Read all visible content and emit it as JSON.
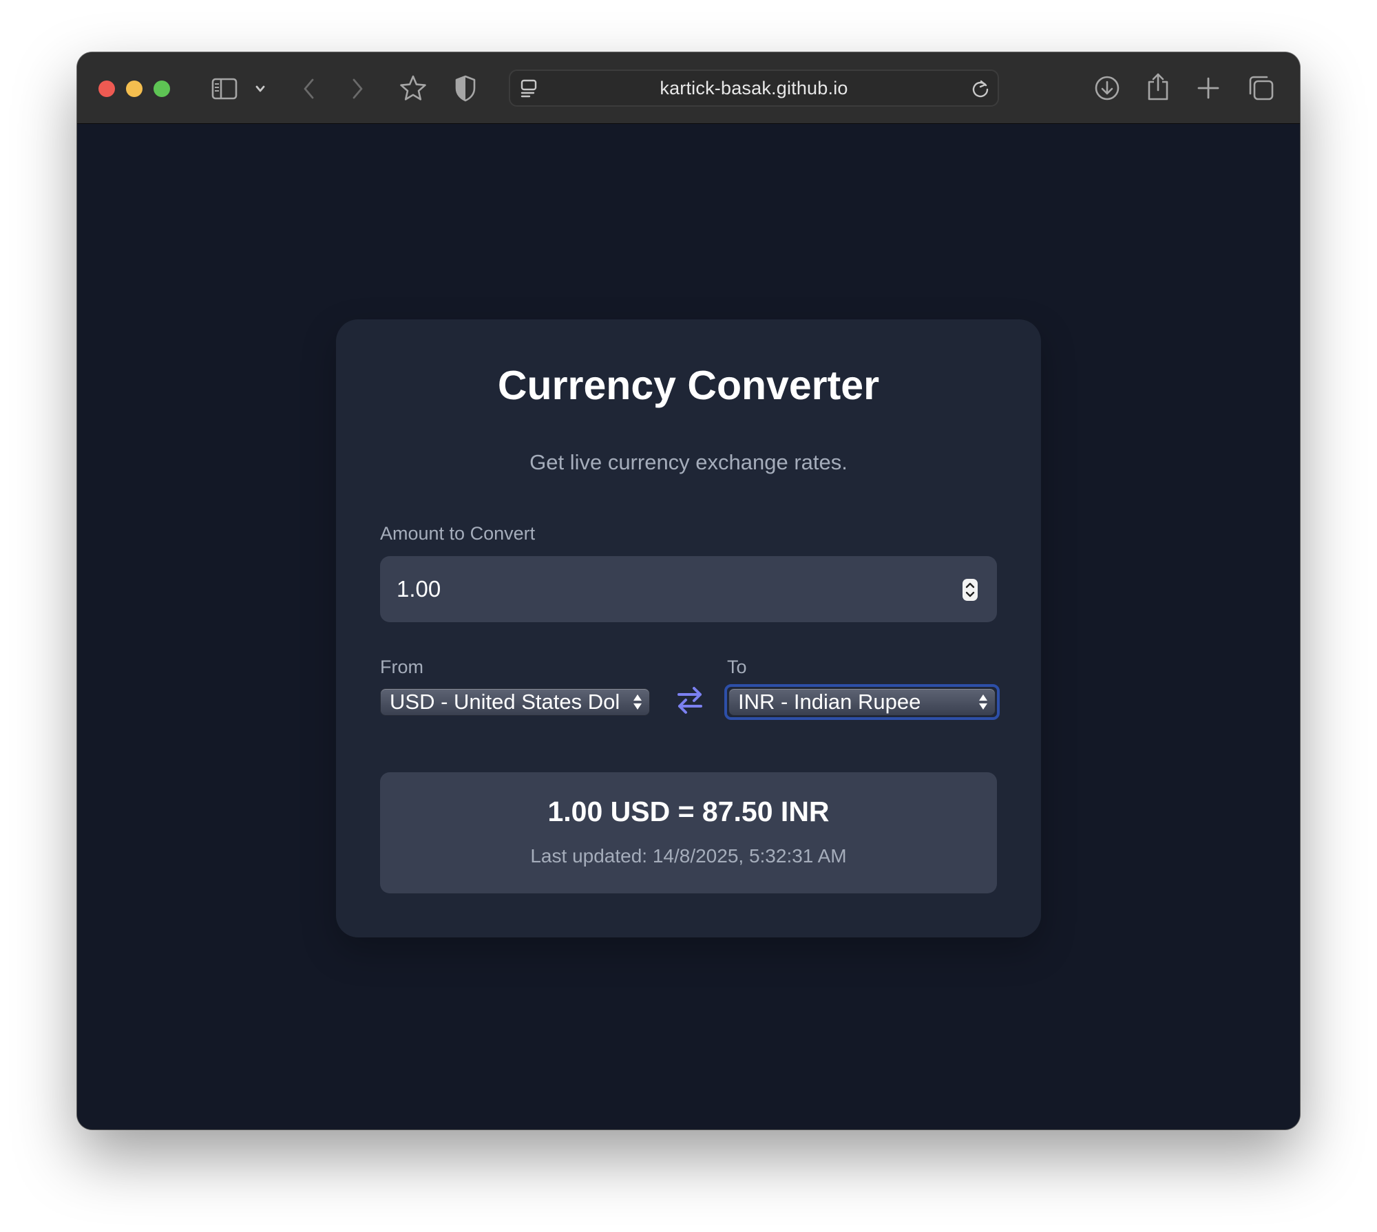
{
  "browser": {
    "url": "kartick-basak.github.io",
    "colors": {
      "close": "#ee5a52",
      "minimize": "#f4be4f",
      "maximize": "#5ec454",
      "chrome": "#2e2e2e"
    },
    "icons": [
      "sidebar-icon",
      "chevron-down-icon",
      "back-icon",
      "forward-icon",
      "star-icon",
      "shield-icon",
      "page-menu-icon",
      "reload-icon",
      "download-icon",
      "share-icon",
      "plus-icon",
      "tabs-overview-icon"
    ]
  },
  "app": {
    "title": "Currency Converter",
    "subtitle": "Get live currency exchange rates.",
    "amount": {
      "label": "Amount to Convert",
      "value": "1.00"
    },
    "from": {
      "label": "From",
      "selected": "USD - United States Dollar"
    },
    "to": {
      "label": "To",
      "selected": "INR - Indian Rupee"
    },
    "result": {
      "conversion": "1.00 USD = 87.50 INR",
      "updated": "Last updated: 14/8/2025, 5:32:31 AM"
    },
    "colors": {
      "background": "#131826",
      "card": "#1f2636",
      "field": "#394052",
      "accent": "#7b80f0",
      "muted_text": "#a5adbb",
      "focus_ring": "#2d4fa8"
    }
  }
}
